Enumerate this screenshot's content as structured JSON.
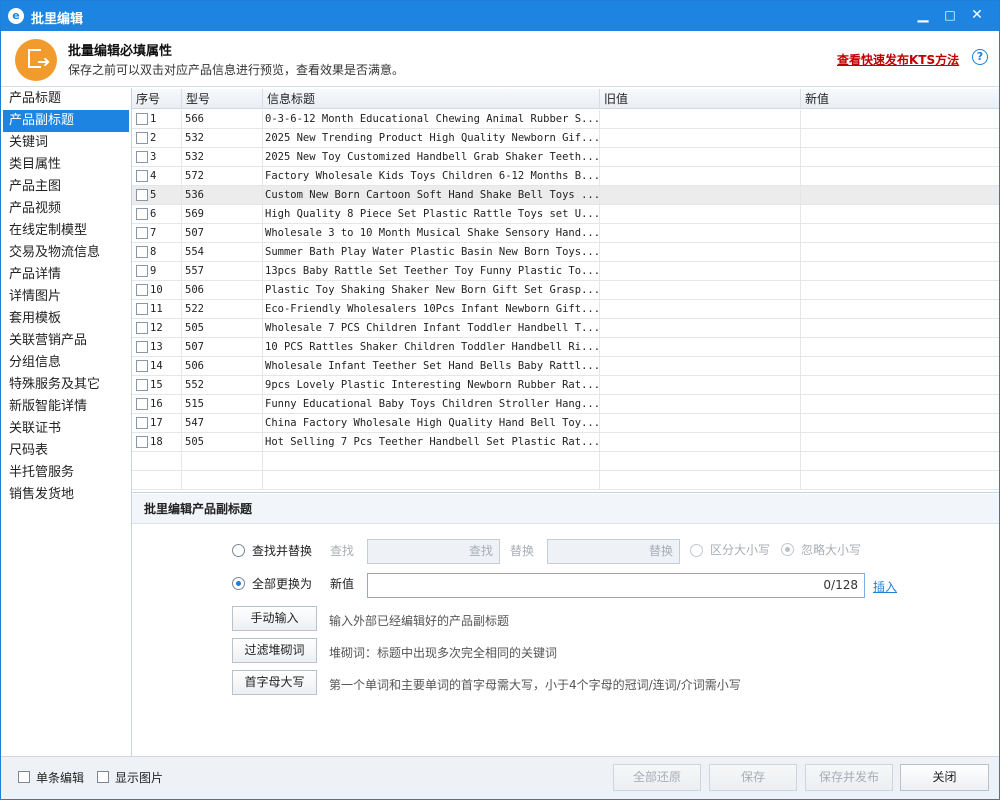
{
  "window": {
    "title": "批里编辑",
    "min": "▁",
    "max": "□",
    "close": "✕"
  },
  "header": {
    "title": "批量编辑必填属性",
    "desc": "保存之前可以双击对应产品信息进行预览，查看效果是否满意。",
    "link": "查看快速发布KTS方法",
    "help": "?"
  },
  "sidebar": {
    "items": [
      "产品标题",
      "产品副标题",
      "关键词",
      "类目属性",
      "产品主图",
      "产品视频",
      "在线定制模型",
      "交易及物流信息",
      "产品详情",
      "详情图片",
      "套用模板",
      "关联营销产品",
      "分组信息",
      "特殊服务及其它",
      "新版智能详情",
      "关联证书",
      "尺码表",
      "半托管服务",
      "销售发货地"
    ],
    "active_index": 1
  },
  "grid": {
    "columns": [
      "序号",
      "型号",
      "信息标题",
      "旧值",
      "新值"
    ],
    "selected_row": 4,
    "rows": [
      {
        "no": "1",
        "model": "566",
        "title": "0-3-6-12 Month Educational Chewing Animal Rubber S..."
      },
      {
        "no": "2",
        "model": "532",
        "title": "2025 New Trending Product High Quality Newborn Gif..."
      },
      {
        "no": "3",
        "model": "532",
        "title": "2025 New Toy Customized Handbell Grab Shaker Teeth..."
      },
      {
        "no": "4",
        "model": "572",
        "title": "Factory Wholesale Kids Toys Children 6-12 Months B..."
      },
      {
        "no": "5",
        "model": "536",
        "title": "Custom New Born Cartoon Soft Hand Shake Bell Toys ..."
      },
      {
        "no": "6",
        "model": "569",
        "title": "High Quality 8 Piece Set Plastic Rattle Toys set U..."
      },
      {
        "no": "7",
        "model": "507",
        "title": "Wholesale 3 to 10 Month Musical Shake Sensory Hand..."
      },
      {
        "no": "8",
        "model": "554",
        "title": "Summer Bath Play Water Plastic Basin New Born Toys..."
      },
      {
        "no": "9",
        "model": "557",
        "title": "13pcs Baby Rattle Set Teether Toy Funny Plastic To..."
      },
      {
        "no": "10",
        "model": "506",
        "title": "Plastic Toy Shaking Shaker New Born Gift Set Grasp..."
      },
      {
        "no": "11",
        "model": "522",
        "title": "Eco-Friendly Wholesalers 10Pcs Infant Newborn Gift..."
      },
      {
        "no": "12",
        "model": "505",
        "title": "Wholesale 7 PCS Children Infant Toddler Handbell T..."
      },
      {
        "no": "13",
        "model": "507",
        "title": "10 PCS Rattles Shaker Children Toddler Handbell Ri..."
      },
      {
        "no": "14",
        "model": "506",
        "title": "Wholesale Infant Teether Set Hand Bells Baby Rattl..."
      },
      {
        "no": "15",
        "model": "552",
        "title": "9pcs Lovely Plastic Interesting Newborn Rubber Rat..."
      },
      {
        "no": "16",
        "model": "515",
        "title": "Funny Educational Baby Toys Children Stroller Hang..."
      },
      {
        "no": "17",
        "model": "547",
        "title": "China Factory Wholesale High Quality Hand Bell Toy..."
      },
      {
        "no": "18",
        "model": "505",
        "title": "Hot Selling 7 Pcs Teether Handbell Set Plastic Rat..."
      }
    ]
  },
  "edit": {
    "title": "批里编辑产品副标题",
    "find_replace": "查找并替换",
    "find_label": "查找",
    "find_placeholder": "查找",
    "replace_label": "替换",
    "replace_placeholder": "替换",
    "case_sensitive": "区分大小写",
    "ignore_case": "忽略大小写",
    "replace_all": "全部更换为",
    "new_value_label": "新值",
    "counter": "0/128",
    "insert": "插入",
    "manual_btn": "手动输入",
    "manual_hint": "输入外部已经编辑好的产品副标题",
    "filter_btn": "过滤堆砌词",
    "filter_hint": "堆砌词：标题中出现多次完全相同的关键词",
    "cap_btn": "首字母大写",
    "cap_hint": "第一个单词和主要单词的首字母需大写，小于4个字母的冠词/连词/介词需小写"
  },
  "footer": {
    "single_edit": "单条编辑",
    "show_image": "显示图片",
    "restore_all": "全部还原",
    "save": "保存",
    "save_publish": "保存并发布",
    "close": "关闭"
  }
}
